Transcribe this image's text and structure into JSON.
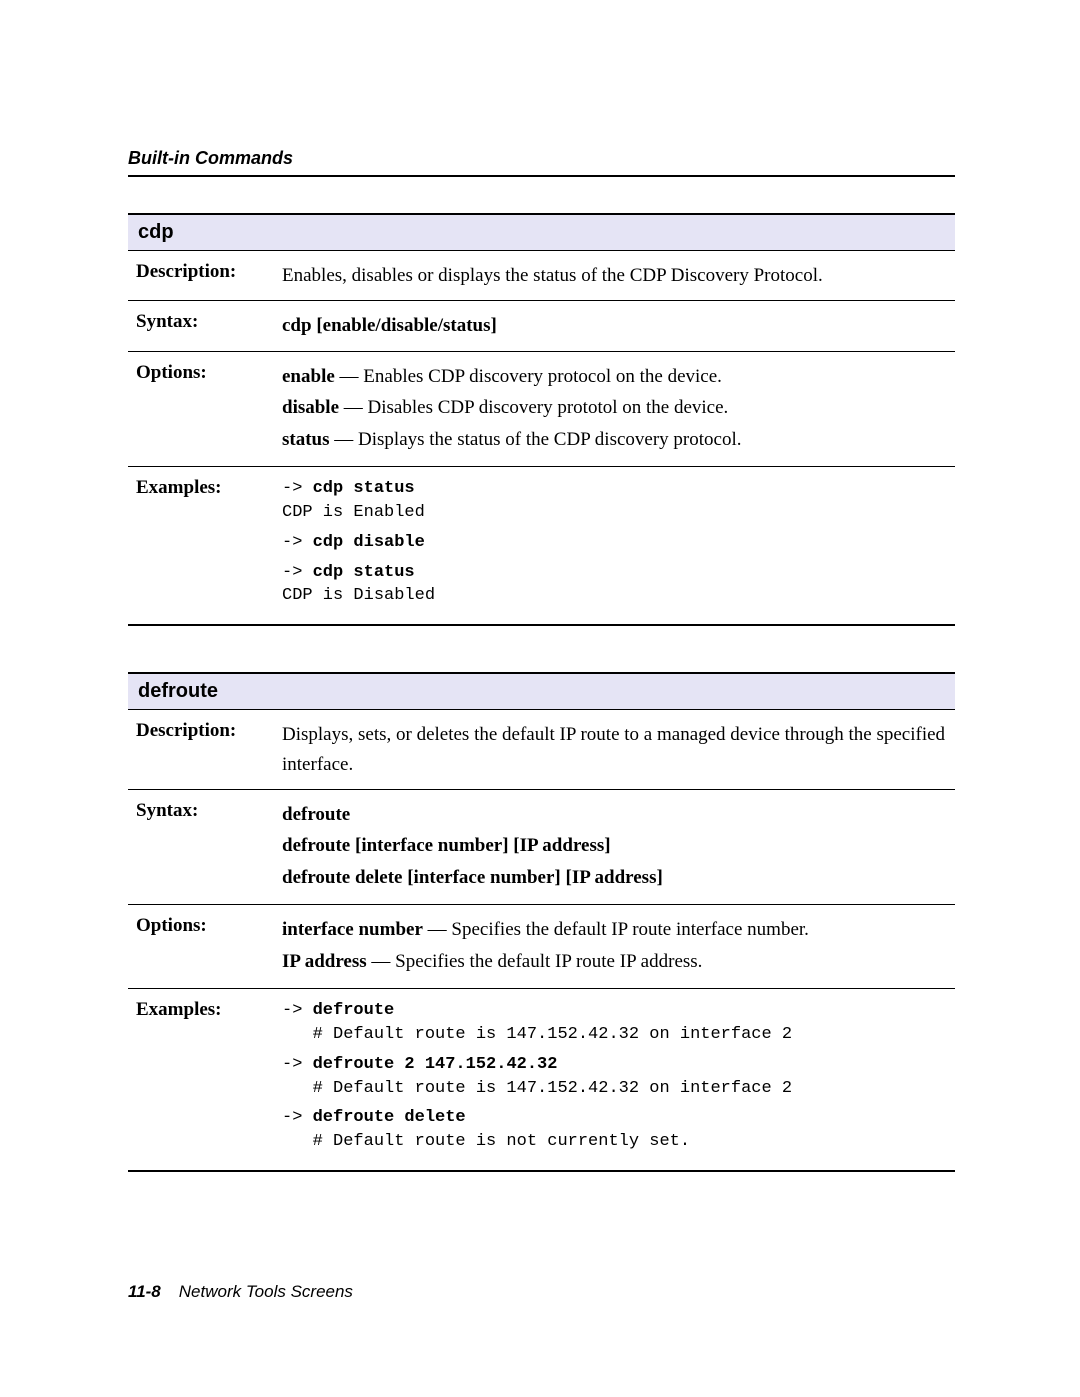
{
  "header": "Built-in Commands",
  "footer": {
    "page": "11-8",
    "title": "Network Tools Screens"
  },
  "labels": {
    "description": "Description:",
    "syntax": "Syntax:",
    "options": "Options:",
    "examples": "Examples:"
  },
  "cdp": {
    "title": "cdp",
    "description": "Enables, disables or displays the status of the CDP Discovery Protocol.",
    "syntax": "cdp [enable/disable/status]",
    "options": [
      {
        "term": "enable",
        "desc": " — Enables CDP discovery protocol on the device."
      },
      {
        "term": "disable",
        "desc": " — Disables CDP discovery prototol on the device."
      },
      {
        "term": "status",
        "desc": " — Displays the status of the CDP discovery protocol."
      }
    ],
    "examples": [
      {
        "prompt": "-> ",
        "cmd": "cdp status",
        "out": "CDP is Enabled"
      },
      {
        "prompt": "-> ",
        "cmd": "cdp disable",
        "out": ""
      },
      {
        "prompt": "-> ",
        "cmd": "cdp status",
        "out": "CDP is Disabled"
      }
    ]
  },
  "defroute": {
    "title": "defroute",
    "description": "Displays, sets, or deletes the default IP route to a managed device through the specified interface.",
    "syntax": [
      "defroute",
      "defroute [interface number] [IP address]",
      "defroute delete [interface number] [IP address]"
    ],
    "options": [
      {
        "term": "interface number",
        "desc": " — Specifies the default IP route interface number."
      },
      {
        "term": "IP address",
        "desc": " — Specifies the default IP route IP address."
      }
    ],
    "examples": [
      {
        "prompt": "-> ",
        "cmd": "defroute",
        "out": "   # Default route is 147.152.42.32 on interface 2"
      },
      {
        "prompt": "-> ",
        "cmd": "defroute 2 147.152.42.32",
        "out": "   # Default route is 147.152.42.32 on interface 2"
      },
      {
        "prompt": "-> ",
        "cmd": "defroute delete",
        "out": "   # Default route is not currently set."
      }
    ]
  }
}
